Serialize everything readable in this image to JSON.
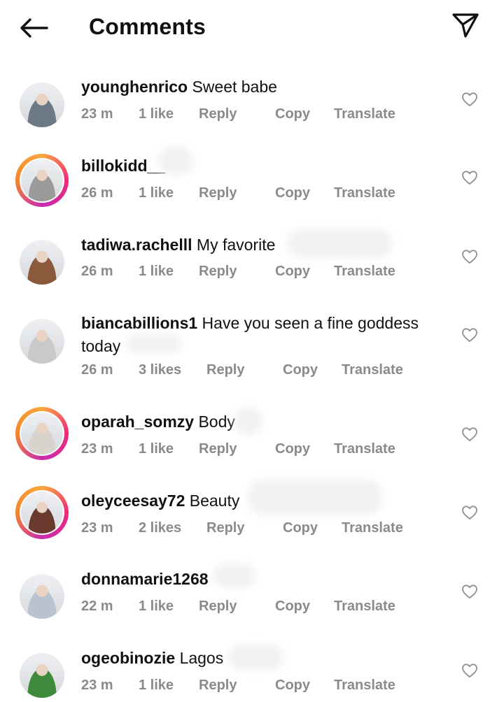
{
  "header": {
    "title": "Comments",
    "back_icon": "arrow-left-icon",
    "send_icon": "paper-plane-icon"
  },
  "colors": {
    "text": "#111111",
    "meta": "#8a8a8a",
    "story_ring": "#ee2a7b"
  },
  "comments": [
    {
      "username": "younghenrico",
      "text": "Sweet babe",
      "continuation": "",
      "time": "23 m",
      "likes": "1 like",
      "reply": "Reply",
      "copy": "Copy",
      "translate": "Translate",
      "story": false,
      "avatar_color": "#6d7a85"
    },
    {
      "username": "billokidd__",
      "text": "",
      "continuation": "",
      "time": "26 m",
      "likes": "1 like",
      "reply": "Reply",
      "copy": "Copy",
      "translate": "Translate",
      "story": true,
      "avatar_color": "#9a9a9a"
    },
    {
      "username": "tadiwa.rachelll",
      "text": "My favorite",
      "continuation": "",
      "time": "26 m",
      "likes": "1 like",
      "reply": "Reply",
      "copy": "Copy",
      "translate": "Translate",
      "story": false,
      "avatar_color": "#8b5a3c"
    },
    {
      "username": "biancabillions1",
      "text": "Have you seen a fine goddess",
      "continuation": "today",
      "time": "26 m",
      "likes": "3 likes",
      "reply": "Reply",
      "copy": "Copy",
      "translate": "Translate",
      "story": false,
      "avatar_color": "#c9c9c9"
    },
    {
      "username": "oparah_somzy",
      "text": "Body",
      "continuation": "",
      "time": "23 m",
      "likes": "1 like",
      "reply": "Reply",
      "copy": "Copy",
      "translate": "Translate",
      "story": true,
      "avatar_color": "#d8d3cc"
    },
    {
      "username": "oleyceesay72",
      "text": "Beauty",
      "continuation": "",
      "time": "23 m",
      "likes": "2 likes",
      "reply": "Reply",
      "copy": "Copy",
      "translate": "Translate",
      "story": true,
      "avatar_color": "#6a3a2e"
    },
    {
      "username": "donnamarie1268",
      "text": "",
      "continuation": "",
      "time": "22 m",
      "likes": "1 like",
      "reply": "Reply",
      "copy": "Copy",
      "translate": "Translate",
      "story": false,
      "avatar_color": "#b9c3cf"
    },
    {
      "username": "ogeobinozie",
      "text": "Lagos",
      "continuation": "",
      "time": "23 m",
      "likes": "1 like",
      "reply": "Reply",
      "copy": "Copy",
      "translate": "Translate",
      "story": false,
      "avatar_color": "#3f8a3a"
    }
  ]
}
